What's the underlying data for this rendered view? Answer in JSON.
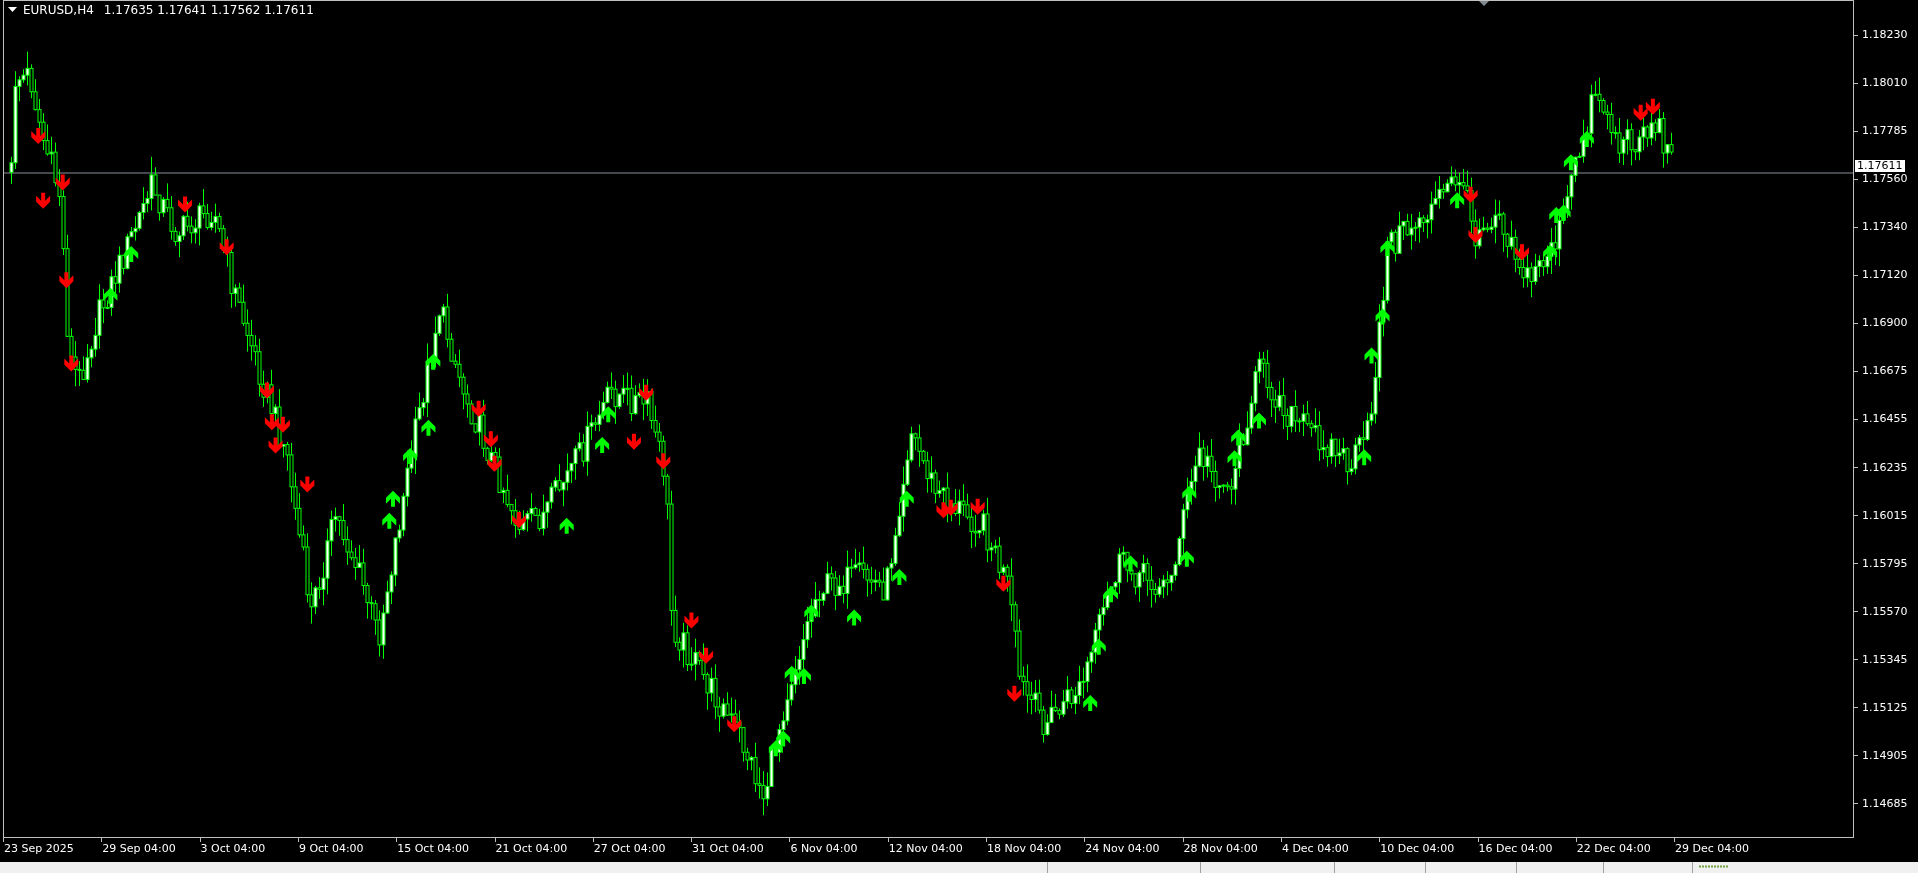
{
  "header": {
    "symbol": "EURUSD,H4",
    "ohlc": "1.17635 1.17641 1.17562 1.17611"
  },
  "price_axis": {
    "labels": [
      "1.18230",
      "1.18010",
      "1.17785",
      "1.17560",
      "1.17340",
      "1.17120",
      "1.16900",
      "1.16675",
      "1.16455",
      "1.16235",
      "1.16015",
      "1.15795",
      "1.15570",
      "1.15345",
      "1.15125",
      "1.14905",
      "1.14685"
    ],
    "current_price": "1.17611"
  },
  "time_axis": {
    "labels": [
      "23 Sep 2025",
      "29 Sep 04:00",
      "3 Oct 04:00",
      "9 Oct 04:00",
      "15 Oct 04:00",
      "21 Oct 04:00",
      "27 Oct 04:00",
      "31 Oct 04:00",
      "6 Nov 04:00",
      "12 Nov 04:00",
      "18 Nov 04:00",
      "24 Nov 04:00",
      "28 Nov 04:00",
      "4 Dec 04:00",
      "10 Dec 04:00",
      "16 Dec 04:00",
      "22 Dec 04:00",
      "29 Dec 04:00"
    ]
  }
}
